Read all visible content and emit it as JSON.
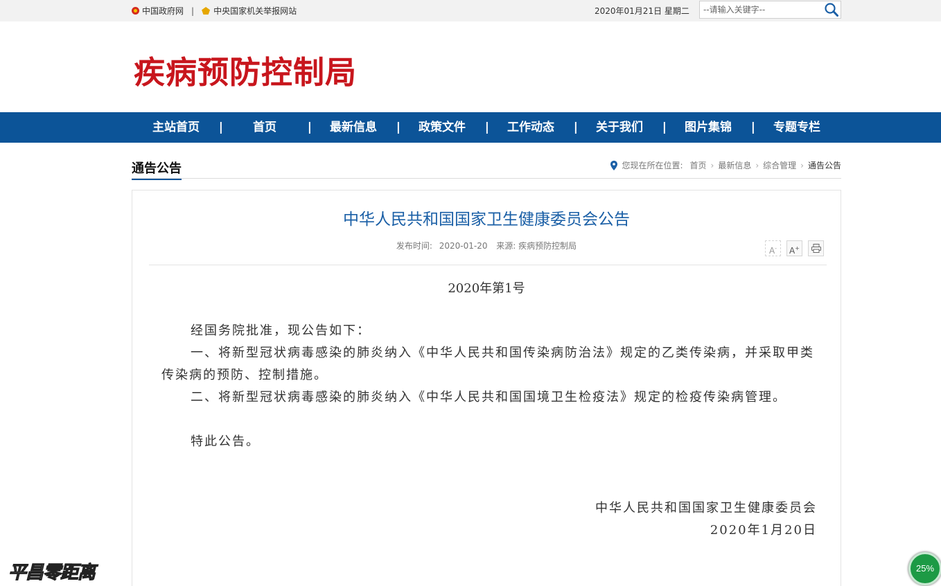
{
  "topbar": {
    "link1": "中国政府网",
    "separator": "|",
    "link2": "中央国家机关举报网站",
    "date": "2020年01月21日 星期二",
    "search_placeholder": "--请输入关键字--"
  },
  "header": {
    "logo_text": "疾病预防控制局",
    "logo_color": "#c8161d"
  },
  "nav": {
    "background": "#0c5498",
    "items": [
      "主站首页",
      "首页",
      "最新信息",
      "政策文件",
      "工作动态",
      "关于我们",
      "图片集锦",
      "专题专栏"
    ]
  },
  "section": {
    "title": "通告公告",
    "breadcrumb_label": "您现在所在位置:",
    "breadcrumb": [
      "首页",
      "最新信息",
      "综合管理",
      "通告公告"
    ]
  },
  "article": {
    "title": "中华人民共和国国家卫生健康委员会公告",
    "publish_label": "发布时间:",
    "publish_date": "2020-01-20",
    "source": "来源: 疾病预防控制局",
    "tools": {
      "font_smaller": "A",
      "font_larger": "A",
      "print_icon": "printer-icon"
    },
    "issue": "2020年第1号",
    "paragraphs": [
      "经国务院批准，现公告如下：",
      "一、将新型冠状病毒感染的肺炎纳入《中华人民共和国传染病防治法》规定的乙类传染病，并采取甲类传染病的预防、控制措施。",
      "二、将新型冠状病毒感染的肺炎纳入《中华人民共和国国境卫生检疫法》规定的检疫传染病管理。",
      "特此公告。"
    ],
    "signature": "中华人民共和国国家卫生健康委员会",
    "signature_date": "2020年1月20日"
  },
  "overlay": {
    "watermark": "平昌零距离",
    "progress_percent": "25%"
  }
}
